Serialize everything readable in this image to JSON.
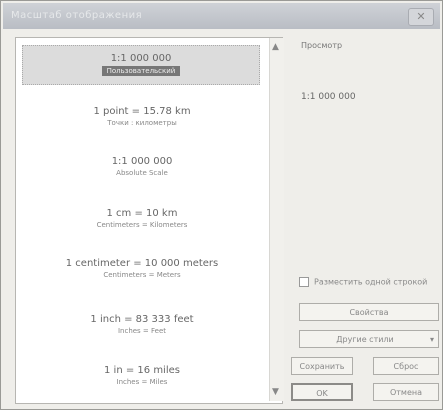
{
  "window": {
    "title": "Масштаб отображения",
    "close_label": "✕"
  },
  "list": {
    "items": [
      {
        "main": "1:1 000 000",
        "sub": "Пользовательский"
      },
      {
        "main": "1 point = 15.78 km",
        "sub": "Точки : километры"
      },
      {
        "main": "1:1 000 000",
        "sub": "Absolute Scale"
      },
      {
        "main": "1 cm = 10 km",
        "sub": "Centimeters = Kilometers"
      },
      {
        "main": "1 centimeter = 10 000 meters",
        "sub": "Centimeters = Meters"
      },
      {
        "main": "1 inch = 83 333 feet",
        "sub": "Inches = Feet"
      },
      {
        "main": "1 in = 16 miles",
        "sub": "Inches = Miles"
      }
    ]
  },
  "preview": {
    "label": "Просмотр",
    "value": "1:1 000 000"
  },
  "checkbox": {
    "label": "Разместить одной строкой"
  },
  "buttons": {
    "properties": "Свойства",
    "more": "Другие стили",
    "save": "Сохранить",
    "reset": "Сброс",
    "ok": "OK",
    "cancel": "Отмена"
  }
}
